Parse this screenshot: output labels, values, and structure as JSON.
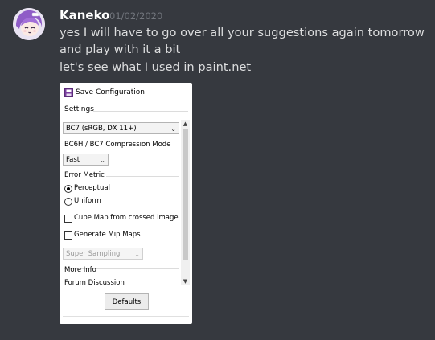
{
  "message": {
    "username": "Kaneko",
    "timestamp": "01/02/2020",
    "lines": [
      "yes I will have to go over all your suggestions again tomorrow",
      "and play with it a bit",
      "let's see what I used in paint.net"
    ]
  },
  "dialog": {
    "save_label": "Save Configuration",
    "settings_label": "Settings",
    "format_value": "BC7 (sRGB, DX 11+)",
    "compression_label": "BC6H / BC7 Compression Mode",
    "compression_value": "Fast",
    "error_metric_label": "Error Metric",
    "perceptual_label": "Perceptual",
    "uniform_label": "Uniform",
    "error_metric_selected": "Perceptual",
    "cube_map_label": "Cube Map from crossed image",
    "cube_map_checked": false,
    "mipmaps_label": "Generate Mip Maps",
    "mipmaps_checked": false,
    "sampling_value": "Super Sampling",
    "more_info_label": "More Info",
    "forum_link": "Forum Discussion",
    "defaults_label": "Defaults"
  }
}
